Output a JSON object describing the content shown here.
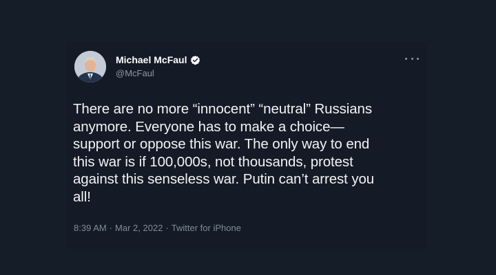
{
  "tweet": {
    "author_name": "Michael McFaul",
    "author_handle": "@McFaul",
    "text": "There are no more “innocent” “neutral” Russians\nanymore. Everyone has to make a choice—\nsupport or oppose this war. The only way to end\nthis war is if 100,000s, not thousands, protest\nagainst this senseless war. Putin can’t arrest you\nall!",
    "time": "8:39 AM",
    "date": "Mar 2, 2022",
    "source": "Twitter for iPhone",
    "separator": "·"
  },
  "icons": {
    "verified": "verified-badge-icon",
    "more": "more-options-icon",
    "avatar": "profile-photo"
  },
  "colors": {
    "background": "#151d28",
    "card": "#141b26",
    "text": "#f2f4f5",
    "secondary_text": "#8b98a5"
  }
}
